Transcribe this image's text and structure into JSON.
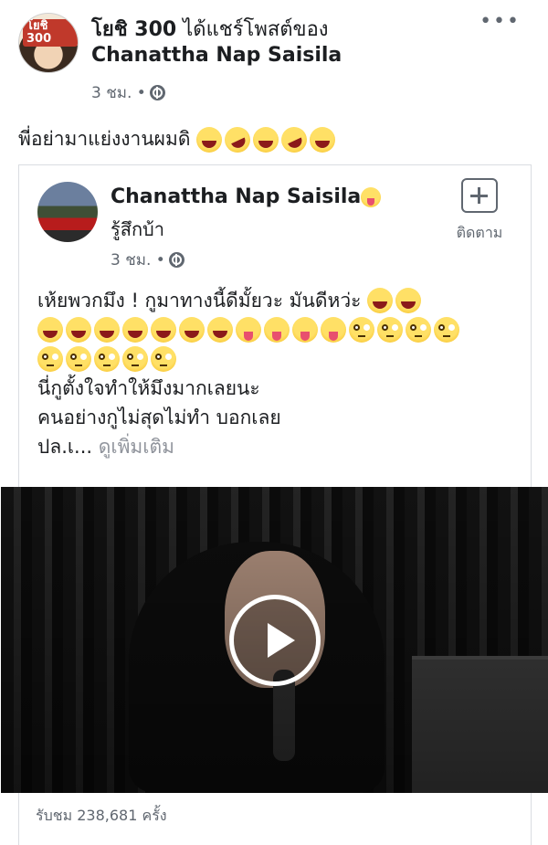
{
  "post": {
    "author": "โยชิ 300",
    "avatar_badge": "โยชิ 300",
    "action": " ได้แชร์โพสต์ของ",
    "shared_from": "Chanattha Nap Saisila",
    "time": "3 ชม. •",
    "privacy_icon": "globe-icon",
    "more_icon": "more-icon",
    "more_glyph": "•••",
    "text": "พี่อย่ามาแย่งงานผมดิ"
  },
  "shared": {
    "author": "Chanattha Nap Saisila",
    "feeling": "รู้สึกบ้า",
    "time": "3 ชม. •",
    "follow_label": "ติดตาม",
    "body_line1": "เห้ยพวกมึง ! กูมาทางนี้ดีมั้ยวะ มันดีหว่ะ",
    "body_line4": "นี่กูตั้งใจทำให้มึงมากเลยนะ",
    "body_line5": "คนอย่างกูไม่สุดไม่ทำ บอกเลย",
    "body_line6": "ปล.เ...",
    "see_more": "ดูเพิ่มเติม",
    "views": "รับชม 238,681 ครั้ง"
  },
  "colors": {
    "text": "#1c1e21",
    "meta": "#606770",
    "see_more": "#90949c",
    "border": "#dadde1"
  }
}
